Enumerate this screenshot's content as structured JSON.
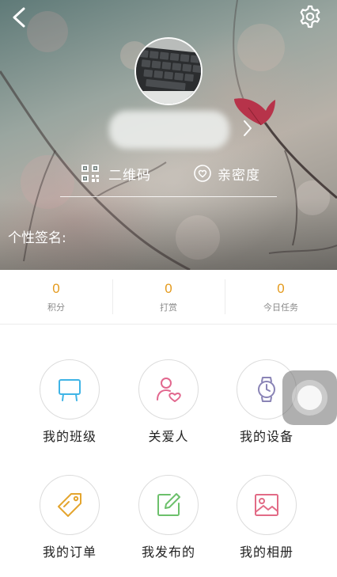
{
  "header": {
    "back_icon": "chevron-left-icon",
    "settings_icon": "gear-icon"
  },
  "profile": {
    "qr_label": "二维码",
    "intimacy_label": "亲密度",
    "signature_label": "个性签名:"
  },
  "stats": [
    {
      "value": "0",
      "label": "积分"
    },
    {
      "value": "0",
      "label": "打赏"
    },
    {
      "value": "0",
      "label": "今日任务"
    }
  ],
  "menu": [
    {
      "label": "我的班级",
      "icon": "class-board-icon",
      "color": "#3fb4e6"
    },
    {
      "label": "关爱人",
      "icon": "person-heart-icon",
      "color": "#e2678e"
    },
    {
      "label": "我的设备",
      "icon": "watch-icon",
      "color": "#8a84b6"
    },
    {
      "label": "我的订单",
      "icon": "tag-icon",
      "color": "#e4a52e"
    },
    {
      "label": "我发布的",
      "icon": "edit-icon",
      "color": "#6cc06b"
    },
    {
      "label": "我的相册",
      "icon": "album-icon",
      "color": "#e26b86"
    }
  ],
  "colors": {
    "accent": "#e49a1c",
    "text": "#222222",
    "muted": "#8a8a8a"
  }
}
